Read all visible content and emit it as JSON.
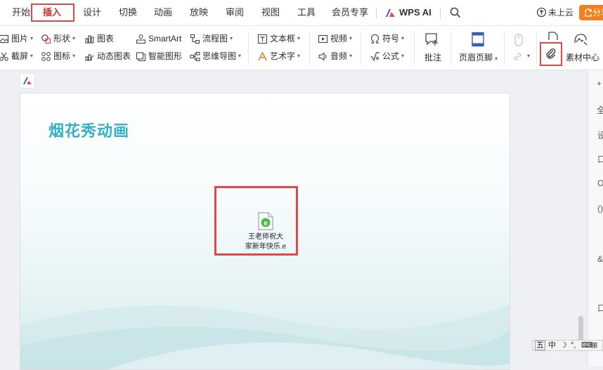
{
  "menu": {
    "items": [
      {
        "label": "开始"
      },
      {
        "label": "插入"
      },
      {
        "label": "设计"
      },
      {
        "label": "切换"
      },
      {
        "label": "动画"
      },
      {
        "label": "放映"
      },
      {
        "label": "审阅"
      },
      {
        "label": "视图"
      },
      {
        "label": "工具"
      },
      {
        "label": "会员专享"
      }
    ],
    "wps_ai": "WPS AI",
    "upload": "未上云",
    "share": "分享"
  },
  "ribbon": {
    "picture": "图片",
    "screenshot": "截屏",
    "shape": "形状",
    "icon_lib": "图标",
    "chart": "图表",
    "dynamic_chart": "动态图表",
    "smartart": "SmartArt",
    "smart_graphic": "智能图形",
    "flowchart": "流程图",
    "mindmap": "思维导图",
    "textbox": "文本框",
    "wordart": "艺术字",
    "video": "视频",
    "audio": "音频",
    "symbol": "符号",
    "formula": "公式",
    "comment": "批注",
    "header_footer": "页眉页脚",
    "material_center": "素材中心"
  },
  "slide": {
    "title": "烟花秀动画",
    "object_label": "王老师祝大家新年快乐.exe",
    "object_label_line1": "王老师祝大",
    "object_label_line2": "家新年快乐.e"
  },
  "right_panel": [
    "+",
    "全",
    "设",
    "口",
    "O",
    "()",
    "&",
    "口"
  ],
  "ime": [
    "五",
    "中",
    "☽",
    "°,",
    "⌨",
    "⊞",
    "⊞"
  ],
  "colors": {
    "accent_red": "#e04848",
    "title_teal": "#35b0c6",
    "share_orange": "#f3801b"
  }
}
